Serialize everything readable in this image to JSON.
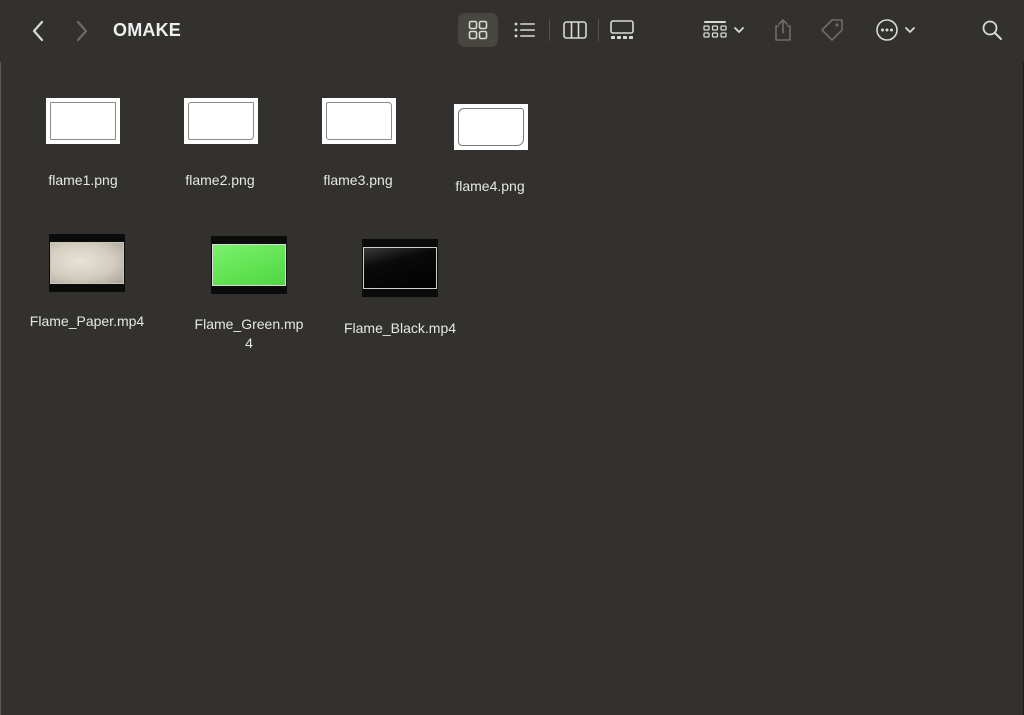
{
  "window": {
    "title": "OMAKE"
  },
  "toolbar": {
    "back": "chevron-left-icon",
    "forward": "chevron-right-icon",
    "views": [
      "icon-view",
      "list-view",
      "column-view",
      "gallery-view"
    ],
    "active_view": "icon-view",
    "group": "group-by-icon",
    "share": "share-icon",
    "tag": "tag-icon",
    "more": "ellipsis-circle-icon",
    "search": "search-icon"
  },
  "files": [
    {
      "name": "flame1.png",
      "kind": "png"
    },
    {
      "name": "flame2.png",
      "kind": "png"
    },
    {
      "name": "flame3.png",
      "kind": "png"
    },
    {
      "name": "flame4.png",
      "kind": "png"
    },
    {
      "name": "Flame_Paper.mp4",
      "kind": "mp4",
      "color": "#d8d4c8"
    },
    {
      "name": "Flame_Green.mp4",
      "line1": "Flame_Green.mp",
      "line2": "4",
      "kind": "mp4",
      "color": "#66e65a"
    },
    {
      "name": "Flame_Black.mp4",
      "kind": "mp4",
      "color": "#050505"
    }
  ],
  "colors": {
    "background": "#32312e",
    "selected_view_bg": "#47463f",
    "text": "#e7e7e7"
  }
}
